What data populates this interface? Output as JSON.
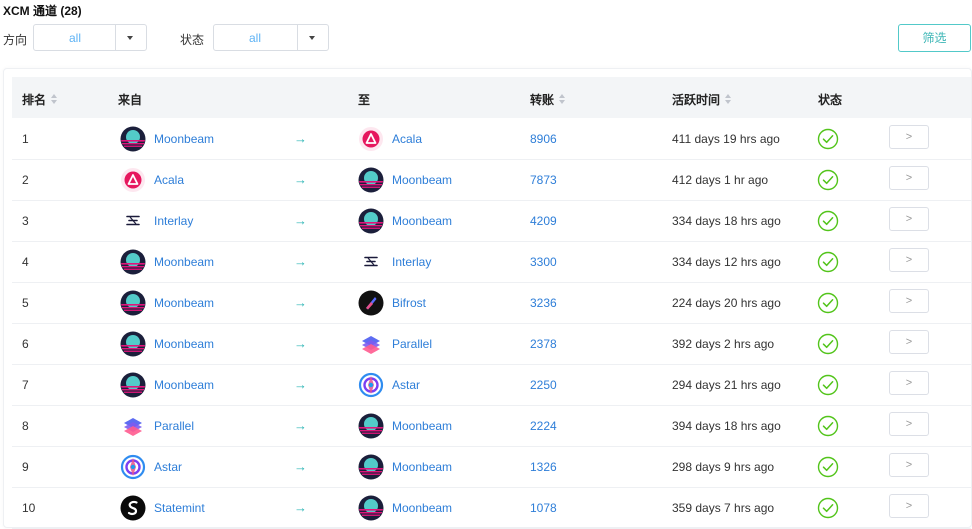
{
  "page": {
    "title": "XCM 通道 (28)"
  },
  "filters": {
    "direction_label": "方向",
    "direction_value": "all",
    "status_label": "状态",
    "status_value": "all",
    "filter_button": "筛选"
  },
  "table": {
    "columns": {
      "rank": "排名",
      "from": "来自",
      "to": "至",
      "transfers": "转账",
      "active_time": "活跃时间",
      "status": "状态"
    },
    "arrow_glyph": "→",
    "row_button_glyph": ">",
    "rows": [
      {
        "rank": "1",
        "from": "Moonbeam",
        "from_icon": "moonbeam-icon",
        "to": "Acala",
        "to_icon": "acala-icon",
        "transfers": "8906",
        "active": "411 days 19 hrs ago",
        "status": "success"
      },
      {
        "rank": "2",
        "from": "Acala",
        "from_icon": "acala-icon",
        "to": "Moonbeam",
        "to_icon": "moonbeam-icon",
        "transfers": "7873",
        "active": "412 days 1 hr ago",
        "status": "success"
      },
      {
        "rank": "3",
        "from": "Interlay",
        "from_icon": "interlay-icon",
        "to": "Moonbeam",
        "to_icon": "moonbeam-icon",
        "transfers": "4209",
        "active": "334 days 18 hrs ago",
        "status": "success"
      },
      {
        "rank": "4",
        "from": "Moonbeam",
        "from_icon": "moonbeam-icon",
        "to": "Interlay",
        "to_icon": "interlay-icon",
        "transfers": "3300",
        "active": "334 days 12 hrs ago",
        "status": "success"
      },
      {
        "rank": "5",
        "from": "Moonbeam",
        "from_icon": "moonbeam-icon",
        "to": "Bifrost",
        "to_icon": "bifrost-icon",
        "transfers": "3236",
        "active": "224 days 20 hrs ago",
        "status": "success"
      },
      {
        "rank": "6",
        "from": "Moonbeam",
        "from_icon": "moonbeam-icon",
        "to": "Parallel",
        "to_icon": "parallel-icon",
        "transfers": "2378",
        "active": "392 days 2 hrs ago",
        "status": "success"
      },
      {
        "rank": "7",
        "from": "Moonbeam",
        "from_icon": "moonbeam-icon",
        "to": "Astar",
        "to_icon": "astar-icon",
        "transfers": "2250",
        "active": "294 days 21 hrs ago",
        "status": "success"
      },
      {
        "rank": "8",
        "from": "Parallel",
        "from_icon": "parallel-icon",
        "to": "Moonbeam",
        "to_icon": "moonbeam-icon",
        "transfers": "2224",
        "active": "394 days 18 hrs ago",
        "status": "success"
      },
      {
        "rank": "9",
        "from": "Astar",
        "from_icon": "astar-icon",
        "to": "Moonbeam",
        "to_icon": "moonbeam-icon",
        "transfers": "1326",
        "active": "298 days 9 hrs ago",
        "status": "success"
      },
      {
        "rank": "10",
        "from": "Statemint",
        "from_icon": "statemint-icon",
        "to": "Moonbeam",
        "to_icon": "moonbeam-icon",
        "transfers": "1078",
        "active": "359 days 7 hrs ago",
        "status": "success"
      }
    ]
  },
  "colors": {
    "link": "#2e7ed8",
    "accent_teal": "#28b4b4",
    "status_ok": "#52c41a",
    "header_bg": "#f3f5f7"
  }
}
